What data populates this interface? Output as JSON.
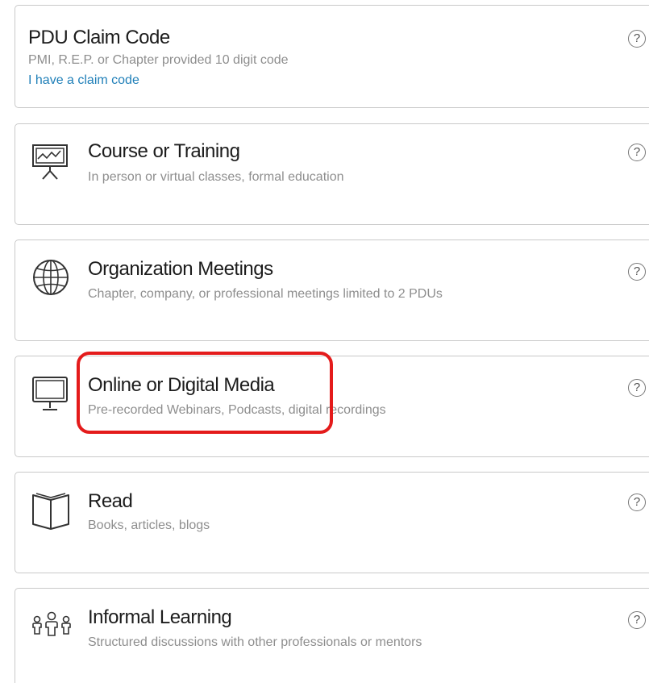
{
  "cards": {
    "claim": {
      "title": "PDU Claim Code",
      "subtitle": "PMI, R.E.P. or Chapter provided 10 digit code",
      "link": "I have a claim code",
      "help": "?"
    },
    "course": {
      "title": "Course or Training",
      "subtitle": "In person or virtual classes, formal education",
      "help": "?",
      "icon": "presentation-board-icon"
    },
    "meetings": {
      "title": "Organization Meetings",
      "subtitle": "Chapter, company, or professional meetings limited to 2 PDUs",
      "help": "?",
      "icon": "globe-icon"
    },
    "online": {
      "title": "Online or Digital Media",
      "subtitle": "Pre-recorded Webinars, Podcasts, digital recordings",
      "help": "?",
      "icon": "monitor-icon"
    },
    "read": {
      "title": "Read",
      "subtitle": "Books, articles, blogs",
      "help": "?",
      "icon": "open-book-icon"
    },
    "informal": {
      "title": "Informal Learning",
      "subtitle": "Structured discussions with other professionals or mentors",
      "help": "?",
      "icon": "people-group-icon"
    }
  },
  "colors": {
    "highlight": "#e41b1b",
    "link": "#1f7fb8",
    "border": "#c9c9c9"
  }
}
